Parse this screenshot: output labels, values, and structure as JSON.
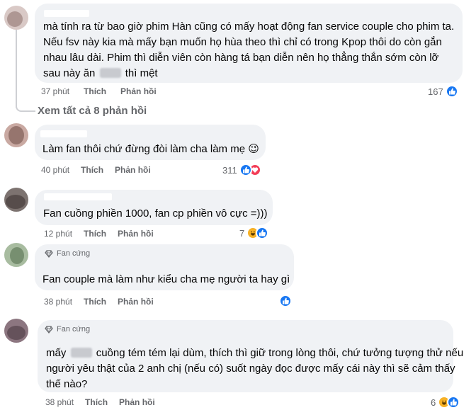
{
  "comments": [
    {
      "lines": [
        "mà tính ra từ bao giờ phim Hàn cũng có mấy hoạt động fan service couple cho phim ta.",
        "Nếu fsv này kia mà mấy bạn muốn họ hùa theo thì chỉ có trong Kpop thôi do còn gắn",
        "nhau lâu dài. Phim thì diễn viên còn hàng tá bạn diễn nên họ thẳng thắn sớm còn lỡ"
      ],
      "last_line_before": "sau này ăn",
      "last_line_after": "thì mệt",
      "time": "37 phút",
      "like": "Thích",
      "reply": "Phản hồi",
      "reaction_count": "167",
      "reactions": [
        "like"
      ]
    },
    {
      "lines": [
        "Làm fan thôi chứ đừng đòi làm cha làm mẹ 😉"
      ],
      "time": "40 phút",
      "like": "Thích",
      "reply": "Phản hồi",
      "reaction_count": "311",
      "reactions": [
        "like",
        "love"
      ]
    },
    {
      "lines": [
        "Fan cuồng phiền 1000, fan cp phiền vô cực =)))"
      ],
      "time": "12 phút",
      "like": "Thích",
      "reply": "Phản hồi",
      "reaction_count": "7",
      "reactions": [
        "haha",
        "like"
      ]
    },
    {
      "badge": "Fan cứng",
      "lines": [
        "Fan couple mà làm như kiểu cha mẹ người ta hay gì"
      ],
      "time": "38 phút",
      "like": "Thích",
      "reply": "Phản hồi",
      "reaction_count": "",
      "reactions": [
        "like"
      ]
    },
    {
      "badge": "Fan cứng",
      "first_line_before": "mấy",
      "first_line_after": "cuồng tém tém lại dùm, thích thì giữ trong lòng thôi, chứ tưởng tượng thử nếu",
      "lines": [
        "người yêu thật của 2 anh chị (nếu có) suốt ngày đọc được mấy cái này thì sẽ cảm thấy",
        "thế nào?"
      ],
      "time": "38 phút",
      "like": "Thích",
      "reply": "Phản hồi",
      "reaction_count": "6",
      "reactions": [
        "haha",
        "like"
      ]
    }
  ],
  "view_more": "Xem tất cả 8 phản hồi",
  "colors": {
    "like": "#1877f2",
    "love": "#f33e58",
    "haha": "#f7b125",
    "bubble": "#f0f2f5",
    "meta": "#65676b"
  }
}
